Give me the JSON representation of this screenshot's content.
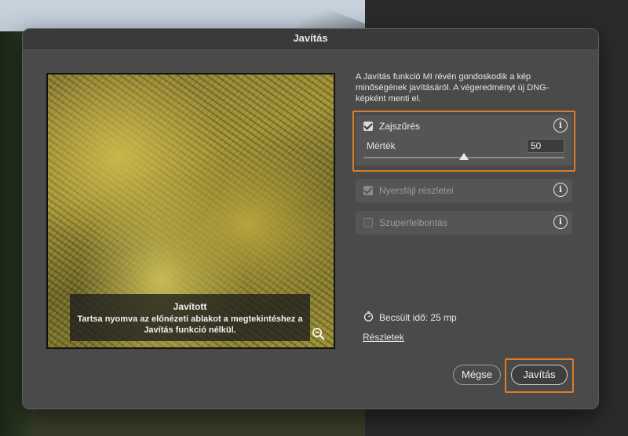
{
  "dialog": {
    "title": "Javítás",
    "description": "A Javítás funkció MI révén gondoskodik a kép minőségének javításáról. A végeredményt új DNG-képként menti el."
  },
  "preview": {
    "caption_title": "Javított",
    "caption_text": "Tartsa nyomva az előnézeti ablakot a megtekintéshez a Javítás funkció nélkül."
  },
  "options": {
    "denoise": {
      "label": "Zajszűrés",
      "checked": true,
      "amount_label": "Mérték",
      "amount_value": "50",
      "amount_fraction": 0.5
    },
    "raw_details": {
      "label": "Nyersfájl részletei",
      "checked": true,
      "disabled": true
    },
    "super_resolution": {
      "label": "Szuperfelbontás",
      "checked": false,
      "disabled": true
    }
  },
  "estimate": {
    "label": "Becsült idő: 25 mp"
  },
  "links": {
    "details": "Részletek"
  },
  "buttons": {
    "cancel": "Mégse",
    "apply": "Javítás"
  },
  "colors": {
    "highlight": "#e07b26",
    "dialog_bg": "#4a4a4a"
  }
}
